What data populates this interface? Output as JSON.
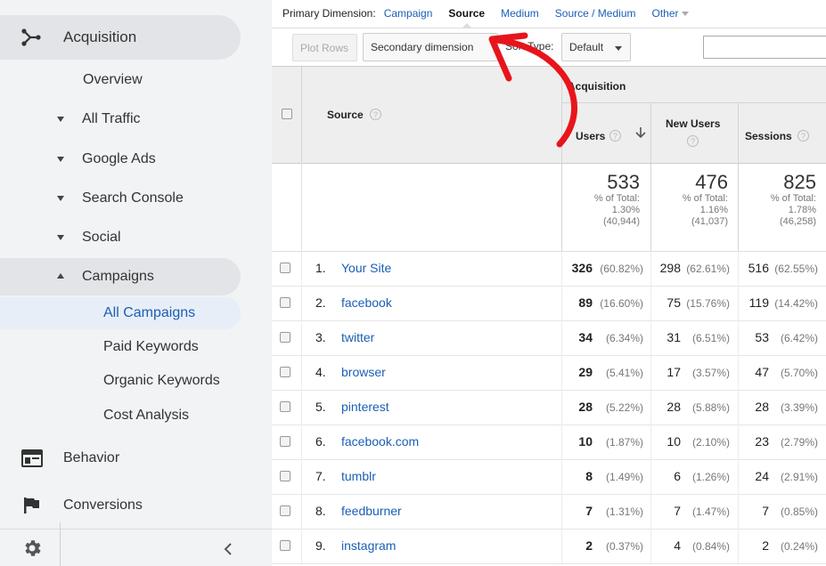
{
  "sidebar": {
    "acquisition": "Acquisition",
    "overview": "Overview",
    "all_traffic": "All Traffic",
    "google_ads": "Google Ads",
    "search_console": "Search Console",
    "social": "Social",
    "campaigns": "Campaigns",
    "all_campaigns": "All Campaigns",
    "paid_keywords": "Paid Keywords",
    "organic_keywords": "Organic Keywords",
    "cost_analysis": "Cost Analysis",
    "behavior": "Behavior",
    "conversions": "Conversions"
  },
  "primary_dimension": {
    "label": "Primary Dimension:",
    "campaign": "Campaign",
    "source": "Source",
    "medium": "Medium",
    "source_medium": "Source / Medium",
    "other": "Other"
  },
  "toolbar": {
    "plot_rows": "Plot Rows",
    "secondary_dimension": "Secondary dimension",
    "sort_type_label": "Sort Type:",
    "sort_type_value": "Default"
  },
  "table": {
    "source_header": "Source",
    "group_header": "Acquisition",
    "users_header": "Users",
    "new_users_header": "New Users",
    "sessions_header": "Sessions",
    "totals": {
      "users": {
        "value": "533",
        "pct_label": "% of Total:",
        "pct": "1.30%",
        "of": "(40,944)"
      },
      "new_users": {
        "value": "476",
        "pct_label": "% of Total:",
        "pct": "1.16%",
        "of": "(41,037)"
      },
      "sessions": {
        "value": "825",
        "pct_label": "% of Total:",
        "pct": "1.78%",
        "of": "(46,258)"
      }
    },
    "rows": [
      {
        "num": "1.",
        "source": "Your Site",
        "users": "326",
        "users_pct": "(60.82%)",
        "new_users": "298",
        "new_users_pct": "(62.61%)",
        "sessions": "516",
        "sessions_pct": "(62.55%)"
      },
      {
        "num": "2.",
        "source": "facebook",
        "users": "89",
        "users_pct": "(16.60%)",
        "new_users": "75",
        "new_users_pct": "(15.76%)",
        "sessions": "119",
        "sessions_pct": "(14.42%)"
      },
      {
        "num": "3.",
        "source": "twitter",
        "users": "34",
        "users_pct": "(6.34%)",
        "new_users": "31",
        "new_users_pct": "(6.51%)",
        "sessions": "53",
        "sessions_pct": "(6.42%)"
      },
      {
        "num": "4.",
        "source": "browser",
        "users": "29",
        "users_pct": "(5.41%)",
        "new_users": "17",
        "new_users_pct": "(3.57%)",
        "sessions": "47",
        "sessions_pct": "(5.70%)"
      },
      {
        "num": "5.",
        "source": "pinterest",
        "users": "28",
        "users_pct": "(5.22%)",
        "new_users": "28",
        "new_users_pct": "(5.88%)",
        "sessions": "28",
        "sessions_pct": "(3.39%)"
      },
      {
        "num": "6.",
        "source": "facebook.com",
        "users": "10",
        "users_pct": "(1.87%)",
        "new_users": "10",
        "new_users_pct": "(2.10%)",
        "sessions": "23",
        "sessions_pct": "(2.79%)"
      },
      {
        "num": "7.",
        "source": "tumblr",
        "users": "8",
        "users_pct": "(1.49%)",
        "new_users": "6",
        "new_users_pct": "(1.26%)",
        "sessions": "24",
        "sessions_pct": "(2.91%)"
      },
      {
        "num": "8.",
        "source": "feedburner",
        "users": "7",
        "users_pct": "(1.31%)",
        "new_users": "7",
        "new_users_pct": "(1.47%)",
        "sessions": "7",
        "sessions_pct": "(0.85%)"
      },
      {
        "num": "9.",
        "source": "instagram",
        "users": "2",
        "users_pct": "(0.37%)",
        "new_users": "4",
        "new_users_pct": "(0.84%)",
        "sessions": "2",
        "sessions_pct": "(0.24%)"
      }
    ]
  },
  "colors": {
    "link": "#1a5fb4",
    "annotation_arrow": "#e8141c",
    "sidebar_bg": "#f1f3f4",
    "active_item_bg": "#e8eef8"
  }
}
